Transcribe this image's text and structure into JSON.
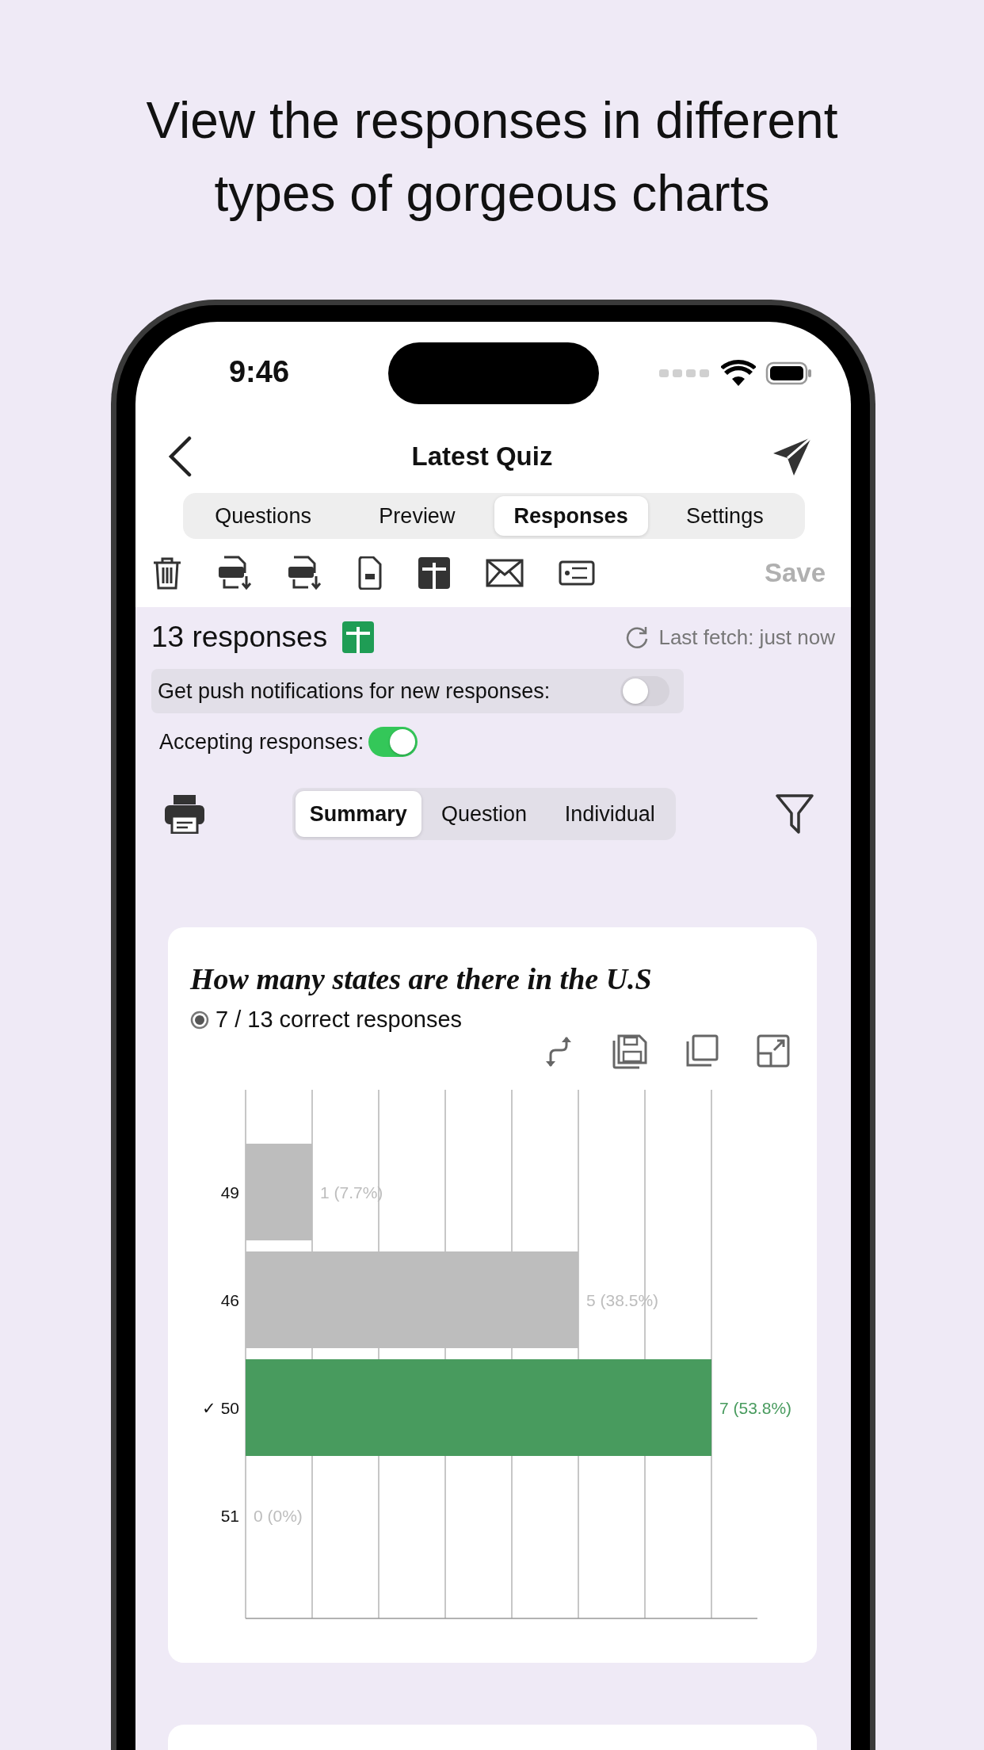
{
  "headline": "View the responses in different types of gorgeous charts",
  "status_bar": {
    "time": "9:46"
  },
  "nav": {
    "title": "Latest Quiz"
  },
  "tabs": [
    {
      "label": "Questions",
      "selected": false
    },
    {
      "label": "Preview",
      "selected": false
    },
    {
      "label": "Responses",
      "selected": true
    },
    {
      "label": "Settings",
      "selected": false
    }
  ],
  "toolbar": {
    "save": "Save",
    "save_disabled": true
  },
  "summary": {
    "count": "13 responses",
    "last_fetch": "Last fetch: just now"
  },
  "push_notifications": {
    "label": "Get push notifications for new responses:",
    "on": false
  },
  "accepting": {
    "label": "Accepting responses:",
    "on": true
  },
  "views": [
    {
      "label": "Summary",
      "selected": true
    },
    {
      "label": "Question",
      "selected": false
    },
    {
      "label": "Individual",
      "selected": false
    }
  ],
  "question": {
    "title": "How many states are there in the U.S",
    "score": "7 / 13 correct responses",
    "options": [
      {
        "correct": false
      },
      {
        "correct": false
      },
      {
        "correct": true
      },
      {
        "correct": false
      }
    ],
    "chart_data": {
      "type": "bar",
      "orientation": "horizontal",
      "categories": [
        "49",
        "46",
        "✓ 50",
        "51"
      ],
      "series": [
        {
          "values": [
            1,
            5,
            7,
            0
          ],
          "value_labels": [
            "1 (7.7%)",
            "5 (38.5%)",
            "7 (53.8%)",
            "0 (0%)"
          ]
        }
      ]
    }
  }
}
